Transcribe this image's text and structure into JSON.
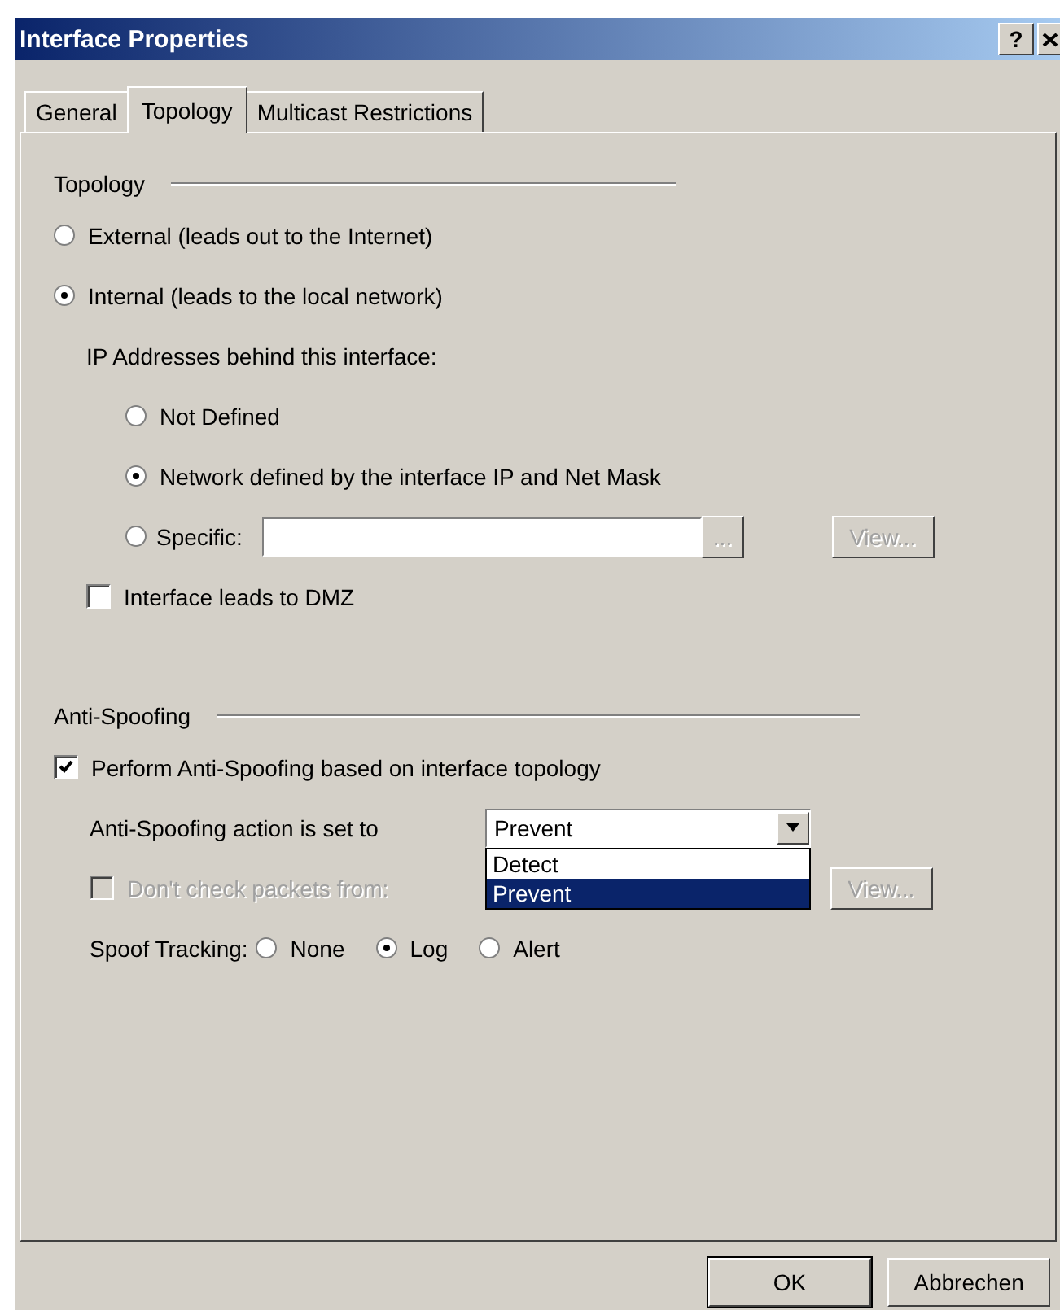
{
  "window": {
    "title": "Interface Properties",
    "help_button": "?"
  },
  "tabs": [
    {
      "label": "General",
      "selected": false
    },
    {
      "label": "Topology",
      "selected": true
    },
    {
      "label": "Multicast Restrictions",
      "selected": false
    }
  ],
  "topology": {
    "title": "Topology",
    "options": [
      {
        "label": "External (leads out to the Internet)",
        "selected": false
      },
      {
        "label": "Internal (leads to the local network)",
        "selected": true
      }
    ],
    "ip_label": "IP Addresses behind this interface:",
    "ip_options": [
      {
        "kind": "radio",
        "label": "Not Defined",
        "selected": false
      },
      {
        "kind": "radio",
        "label": "Network defined by the interface IP and Net Mask",
        "selected": true
      },
      {
        "kind": "field",
        "label": "Specific:",
        "selected": false,
        "browse_button": {
          "label": "...",
          "disabled": true
        },
        "view_button": {
          "label": "View...",
          "disabled": true
        }
      }
    ],
    "dmz": {
      "label": "Interface leads to DMZ",
      "checked": false
    }
  },
  "anti_spoofing": {
    "title": "Anti-Spoofing",
    "perform": {
      "label": "Perform Anti-Spoofing based on interface topology",
      "checked": true
    },
    "action": {
      "label": "Anti-Spoofing action is set to",
      "value": "Prevent",
      "expanded": true,
      "options": [
        {
          "label": "Detect",
          "selected": false
        },
        {
          "label": "Prevent",
          "selected": true
        }
      ]
    },
    "dont_check": {
      "label": "Don't check packets from:",
      "checked": false,
      "disabled": true,
      "view_button": {
        "label": "View...",
        "disabled": true
      }
    },
    "spoof_tracking": {
      "label": "Spoof Tracking:",
      "options": [
        {
          "label": "None",
          "selected": false
        },
        {
          "label": "Log",
          "selected": true
        },
        {
          "label": "Alert",
          "selected": false
        }
      ]
    }
  },
  "buttons": [
    {
      "label": "OK",
      "default": true
    },
    {
      "label": "Abbrechen",
      "default": false
    }
  ]
}
